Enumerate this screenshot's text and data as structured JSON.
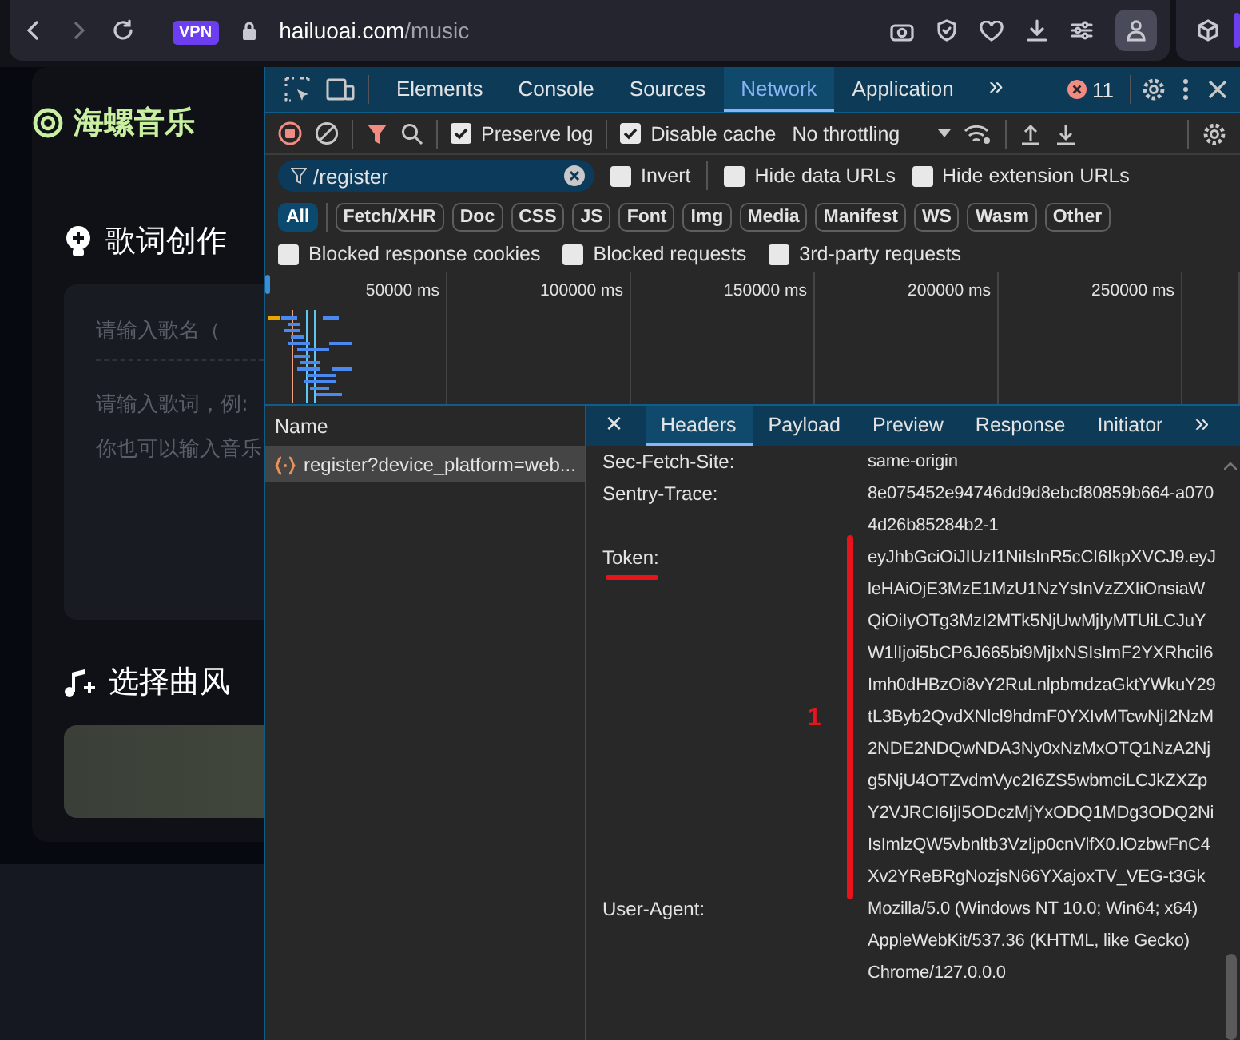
{
  "browser": {
    "vpn_badge": "VPN",
    "url_host": "hailuoai.com",
    "url_path": "/music"
  },
  "page": {
    "logo": "海螺音乐",
    "lyrics_section": {
      "title": "歌词创作",
      "song_name_placeholder": "请输入歌名（",
      "lyrics_placeholder": "请输入歌词，例:\n你也可以输入音乐"
    },
    "style_section": {
      "title": "选择曲风"
    }
  },
  "devtools": {
    "tabs": [
      {
        "label": "Elements",
        "selected": false
      },
      {
        "label": "Console",
        "selected": false
      },
      {
        "label": "Sources",
        "selected": false
      },
      {
        "label": "Network",
        "selected": true
      },
      {
        "label": "Application",
        "selected": false
      }
    ],
    "more_tabs": "»",
    "error_count": "11",
    "toolbar": {
      "options": [
        {
          "label": "Preserve log",
          "checked": true
        },
        {
          "label": "Disable cache",
          "checked": true
        }
      ],
      "throttling": "No throttling"
    },
    "filter": {
      "value": "/register",
      "options": [
        {
          "label": "Invert",
          "checked": false
        },
        {
          "label": "Hide data URLs",
          "checked": false
        },
        {
          "label": "Hide extension URLs",
          "checked": false
        }
      ]
    },
    "type_filters": [
      {
        "label": "All",
        "selected": true
      },
      {
        "label": "Fetch/XHR",
        "selected": false
      },
      {
        "label": "Doc",
        "selected": false
      },
      {
        "label": "CSS",
        "selected": false
      },
      {
        "label": "JS",
        "selected": false
      },
      {
        "label": "Font",
        "selected": false
      },
      {
        "label": "Img",
        "selected": false
      },
      {
        "label": "Media",
        "selected": false
      },
      {
        "label": "Manifest",
        "selected": false
      },
      {
        "label": "WS",
        "selected": false
      },
      {
        "label": "Wasm",
        "selected": false
      },
      {
        "label": "Other",
        "selected": false
      }
    ],
    "extra_filters": [
      {
        "label": "Blocked response cookies",
        "checked": false
      },
      {
        "label": "Blocked requests",
        "checked": false
      },
      {
        "label": "3rd-party requests",
        "checked": false
      }
    ],
    "overview_ticks": [
      "50000 ms",
      "100000 ms",
      "150000 ms",
      "200000 ms",
      "250000 ms"
    ],
    "requests": {
      "column": "Name",
      "rows": [
        {
          "name": "register?device_platform=web...",
          "selected": true
        }
      ]
    },
    "detail": {
      "close": "×",
      "tabs": [
        {
          "label": "Headers",
          "selected": true
        },
        {
          "label": "Payload",
          "selected": false
        },
        {
          "label": "Preview",
          "selected": false
        },
        {
          "label": "Response",
          "selected": false
        },
        {
          "label": "Initiator",
          "selected": false
        }
      ],
      "more_tabs": "»",
      "headers": [
        {
          "name": "Sec-Fetch-Site:",
          "value": "same-origin",
          "highlighted": false
        },
        {
          "name": "Sentry-Trace:",
          "value": "8e075452e94746dd9d8ebcf80859b664-a0704d26b85284b2-1",
          "highlighted": false
        },
        {
          "name": "Token:",
          "value": "eyJhbGciOiJIUzI1NiIsInR5cCI6IkpXVCJ9.eyJleHAiOjE3MzE1MzU1NzYsInVzZXIiOnsiaWQiOiIyOTg3MzI2MTk5NjUwMjIyMTUiLCJuYW1lIjoi5bCP6J665bi9MjIxNSIsImF2YXRhciI6Imh0dHBzOi8vY2RuLnlpbmdzaGktYWkuY29tL3Byb2QvdXNlcl9hdmF0YXIvMTcwNjI2NzM2NDE2NDQwNDA3Ny0xNzMxOTQ1NzA2Njg5NjU4OTZvdmVyc2I6ZS5wbmciLCJkZXZpY2VJRCI6IjI5ODczMjYxODQ1MDg3ODQ2NiIsImlzQW5vbnltb3VzIjp0cnVlfX0.lOzbwFnC4Xv2YReBRgNozjsN66YXajoxTV_VEG-t3Gk",
          "highlighted": true,
          "note": "1"
        },
        {
          "name": "User-Agent:",
          "value": "Mozilla/5.0 (Windows NT 10.0; Win64; x64) AppleWebKit/537.36 (KHTML, like Gecko) Chrome/127.0.0.0",
          "highlighted": false
        }
      ]
    }
  }
}
